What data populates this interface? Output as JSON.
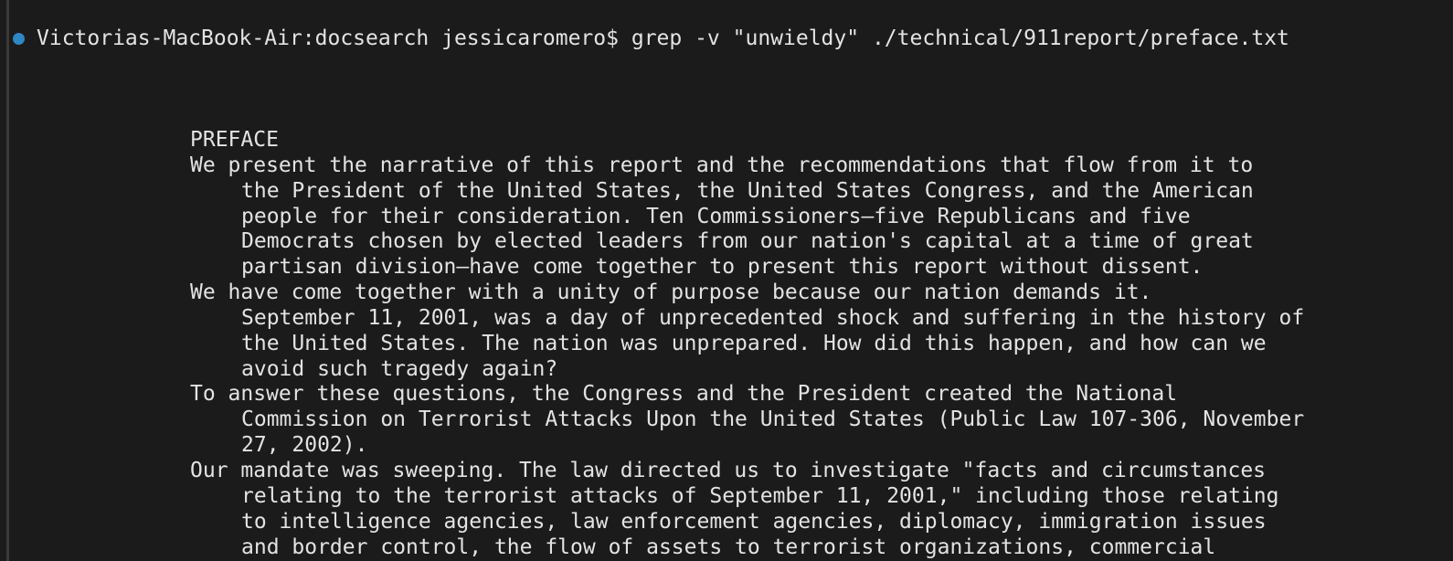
{
  "terminal": {
    "status_dot_color": "#2f87c4",
    "prompt": "Victorias-MacBook-Air:docsearch jessicaromero$",
    "command": "grep -v \"unwieldy\" ./technical/911report/preface.txt",
    "output_lines": [
      {
        "text": "PREFACE",
        "indent": false
      },
      {
        "text": "We present the narrative of this report and the recommendations that flow from it to",
        "indent": false
      },
      {
        "text": "the President of the United States, the United States Congress, and the American",
        "indent": true
      },
      {
        "text": "people for their consideration. Ten Commissioners—five Republicans and five",
        "indent": true
      },
      {
        "text": "Democrats chosen by elected leaders from our nation's capital at a time of great",
        "indent": true
      },
      {
        "text": "partisan division—have come together to present this report without dissent.",
        "indent": true
      },
      {
        "text": "We have come together with a unity of purpose because our nation demands it.",
        "indent": false
      },
      {
        "text": "September 11, 2001, was a day of unprecedented shock and suffering in the history of",
        "indent": true
      },
      {
        "text": "the United States. The nation was unprepared. How did this happen, and how can we",
        "indent": true
      },
      {
        "text": "avoid such tragedy again?",
        "indent": true
      },
      {
        "text": "To answer these questions, the Congress and the President created the National",
        "indent": false
      },
      {
        "text": "Commission on Terrorist Attacks Upon the United States (Public Law 107-306, November",
        "indent": true
      },
      {
        "text": "27, 2002).",
        "indent": true
      },
      {
        "text": "Our mandate was sweeping. The law directed us to investigate \"facts and circumstances",
        "indent": false
      },
      {
        "text": "relating to the terrorist attacks of September 11, 2001,\" including those relating",
        "indent": true
      },
      {
        "text": "to intelligence agencies, law enforcement agencies, diplomacy, immigration issues",
        "indent": true
      },
      {
        "text": "and border control, the flow of assets to terrorist organizations, commercial",
        "indent": true
      }
    ]
  }
}
